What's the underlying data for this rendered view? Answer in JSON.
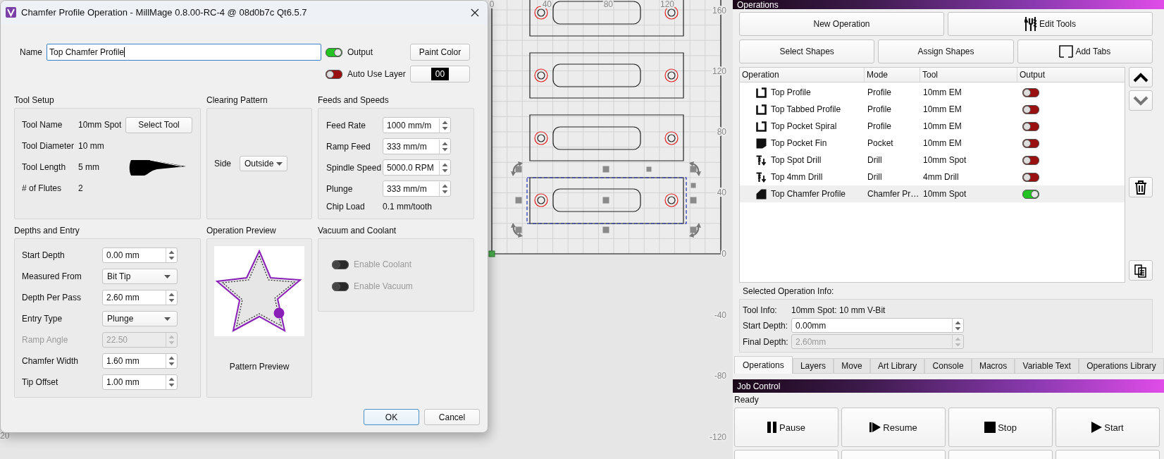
{
  "dialog": {
    "title": "Chamfer Profile Operation - MillMage 0.8.00-RC-4 @ 08d0b7c Qt6.5.7",
    "name_label": "Name",
    "name_value": "Top Chamfer Profile",
    "output": {
      "label": "Output",
      "on": true
    },
    "paint_color_button": "Paint Color",
    "auto_use_layer": {
      "label": "Auto Use Layer",
      "on": false
    },
    "layer": "00",
    "tool_setup": {
      "title": "Tool Setup",
      "select_button": "Select Tool",
      "rows": [
        {
          "label": "Tool Name",
          "value": "10mm Spot"
        },
        {
          "label": "Tool Diameter",
          "value": "10 mm"
        },
        {
          "label": "Tool Length",
          "value": "5 mm"
        },
        {
          "label": "# of Flutes",
          "value": "2"
        }
      ]
    },
    "clearing_pattern": {
      "title": "Clearing Pattern",
      "side_label": "Side",
      "side_value": "Outside"
    },
    "feeds_and_speeds": {
      "title": "Feeds and Speeds",
      "fields": [
        {
          "label": "Feed Rate",
          "value": "1000 mm/m",
          "kind": "spin"
        },
        {
          "label": "Ramp Feed",
          "value": "333 mm/m",
          "kind": "spin"
        },
        {
          "label": "Spindle Speed",
          "value": "5000.0 RPM",
          "kind": "spin"
        },
        {
          "label": "Plunge",
          "value": "333 mm/m",
          "kind": "spin"
        },
        {
          "label": "Chip Load",
          "value": "0.1 mm/tooth",
          "kind": "text"
        }
      ]
    },
    "depths_and_entry": {
      "title": "Depths and Entry",
      "fields": [
        {
          "label": "Start Depth",
          "value": "0.00 mm",
          "kind": "spin",
          "disabled": false
        },
        {
          "label": "Measured From",
          "value": "Bit Tip",
          "kind": "dropdown",
          "disabled": false
        },
        {
          "label": "Depth Per Pass",
          "value": "2.60 mm",
          "kind": "spin",
          "disabled": false
        },
        {
          "label": "Entry Type",
          "value": "Plunge",
          "kind": "dropdown",
          "disabled": false
        },
        {
          "label": "Ramp Angle",
          "value": "22.50",
          "kind": "spin",
          "disabled": true
        },
        {
          "label": "Chamfer Width",
          "value": "1.60 mm",
          "kind": "spin",
          "disabled": false
        },
        {
          "label": "Tip Offset",
          "value": "1.00 mm",
          "kind": "spin",
          "disabled": false
        }
      ]
    },
    "operation_preview": {
      "title": "Operation Preview",
      "caption": "Pattern Preview"
    },
    "vacuum_and_coolant": {
      "title": "Vacuum and Coolant",
      "toggles": [
        {
          "label": "Enable Coolant",
          "on": false,
          "disabled": true
        },
        {
          "label": "Enable Vacuum",
          "on": false,
          "disabled": true
        }
      ]
    },
    "buttons": [
      {
        "label": "OK",
        "default": true
      },
      {
        "label": "Cancel",
        "default": false
      }
    ]
  },
  "canvas": {
    "x_ticks": [
      "0",
      "40",
      "80",
      "120"
    ],
    "y_ticks": [
      "160",
      "120",
      "80",
      "40",
      "0",
      "-40",
      "-80",
      "-120"
    ],
    "ruler_label": "20"
  },
  "operations": {
    "title": "Operations",
    "button_rows": [
      [
        {
          "label": "New Operation",
          "kind": "plain"
        },
        {
          "label": "Edit Tools",
          "kind": "tools"
        }
      ],
      [
        {
          "label": "Select Shapes",
          "kind": "plain"
        },
        {
          "label": "Assign Shapes",
          "kind": "plain"
        },
        {
          "label": "Add Tabs",
          "kind": "tabs"
        }
      ]
    ],
    "columns": [
      "Operation",
      "Mode",
      "Tool",
      "Output"
    ],
    "rows": [
      {
        "kind": "profile",
        "name": "Top Profile",
        "mode": "Profile",
        "tool": "10mm EM",
        "output": false,
        "selected": false
      },
      {
        "kind": "profile",
        "name": "Top Tabbed Profile",
        "mode": "Profile",
        "tool": "10mm EM",
        "output": false,
        "selected": false
      },
      {
        "kind": "profile",
        "name": "Top Pocket Spiral",
        "mode": "Profile",
        "tool": "10mm EM",
        "output": false,
        "selected": false
      },
      {
        "kind": "pocket",
        "name": "Top Pocket Fin",
        "mode": "Pocket",
        "tool": "10mm EM",
        "output": false,
        "selected": false
      },
      {
        "kind": "drill",
        "name": "Top Spot Drill",
        "mode": "Drill",
        "tool": "10mm Spot",
        "output": false,
        "selected": false
      },
      {
        "kind": "drill",
        "name": "Top 4mm Drill",
        "mode": "Drill",
        "tool": "4mm Drill",
        "output": false,
        "selected": false
      },
      {
        "kind": "chamfer",
        "name": "Top Chamfer Profile",
        "mode": "Chamfer Pr…",
        "tool": "10mm Spot",
        "output": true,
        "selected": true
      }
    ],
    "side_buttons": [
      {
        "kind": "up",
        "disabled": false
      },
      {
        "kind": "down",
        "disabled": true
      },
      {
        "kind": "delete",
        "disabled": false
      },
      {
        "kind": "copy",
        "disabled": false
      }
    ],
    "info_title": "Selected Operation Info:",
    "tool_info": {
      "label": "Tool Info:",
      "value": "10mm Spot: 10 mm V-Bit"
    },
    "depths": [
      {
        "label": "Start Depth:",
        "value": "0.00mm",
        "disabled": false
      },
      {
        "label": "Final Depth:",
        "value": "2.60mm",
        "disabled": true
      }
    ],
    "tabs": [
      {
        "label": "Operations",
        "selected": true
      },
      {
        "label": "Layers",
        "selected": false
      },
      {
        "label": "Move",
        "selected": false
      },
      {
        "label": "Art Library",
        "selected": false
      },
      {
        "label": "Console",
        "selected": false
      },
      {
        "label": "Macros",
        "selected": false
      },
      {
        "label": "Variable Text",
        "selected": false
      },
      {
        "label": "Operations Library",
        "selected": false
      }
    ]
  },
  "job_control": {
    "title": "Job Control",
    "status": "Ready",
    "buttons": [
      {
        "label": "Pause",
        "kind": "pause"
      },
      {
        "label": "Resume",
        "kind": "resume"
      },
      {
        "label": "Stop",
        "kind": "stop"
      },
      {
        "label": "Start",
        "kind": "start"
      }
    ]
  }
}
